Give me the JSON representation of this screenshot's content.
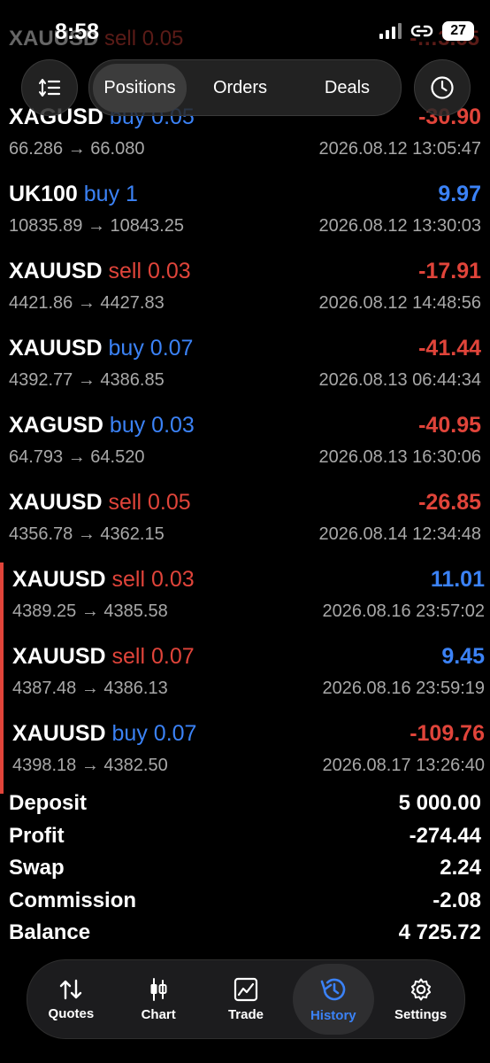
{
  "status": {
    "time": "8:58",
    "battery": "27"
  },
  "ghost": {
    "symbol": "XAUUSD",
    "side": "sell 0.05",
    "pnl": "-…3.65"
  },
  "header": {
    "tabs": [
      {
        "label": "Positions",
        "active": true
      },
      {
        "label": "Orders",
        "active": false
      },
      {
        "label": "Deals",
        "active": false
      }
    ],
    "sort_icon": "sort-icon",
    "clock_icon": "clock-icon"
  },
  "trades": [
    {
      "symbol": "XAGUSD",
      "side": "buy 0.05",
      "dir": "buy",
      "pnl": "-30.90",
      "prices": "66.286 → 66.080",
      "date": "2026.08.12 13:05:47",
      "bar": false
    },
    {
      "symbol": "UK100",
      "side": "buy 1",
      "dir": "buy",
      "pnl": "9.97",
      "prices": "10835.89 → 10843.25",
      "date": "2026.08.12 13:30:03",
      "bar": false
    },
    {
      "symbol": "XAUUSD",
      "side": "sell 0.03",
      "dir": "sell",
      "pnl": "-17.91",
      "prices": "4421.86 → 4427.83",
      "date": "2026.08.12 14:48:56",
      "bar": false
    },
    {
      "symbol": "XAUUSD",
      "side": "buy 0.07",
      "dir": "buy",
      "pnl": "-41.44",
      "prices": "4392.77 → 4386.85",
      "date": "2026.08.13 06:44:34",
      "bar": false
    },
    {
      "symbol": "XAGUSD",
      "side": "buy 0.03",
      "dir": "buy",
      "pnl": "-40.95",
      "prices": "64.793 → 64.520",
      "date": "2026.08.13 16:30:06",
      "bar": false
    },
    {
      "symbol": "XAUUSD",
      "side": "sell 0.05",
      "dir": "sell",
      "pnl": "-26.85",
      "prices": "4356.78 → 4362.15",
      "date": "2026.08.14 12:34:48",
      "bar": false
    },
    {
      "symbol": "XAUUSD",
      "side": "sell 0.03",
      "dir": "sell",
      "pnl": "11.01",
      "prices": "4389.25 → 4385.58",
      "date": "2026.08.16 23:57:02",
      "bar": true
    },
    {
      "symbol": "XAUUSD",
      "side": "sell 0.07",
      "dir": "sell",
      "pnl": "9.45",
      "prices": "4387.48 → 4386.13",
      "date": "2026.08.16 23:59:19",
      "bar": true
    },
    {
      "symbol": "XAUUSD",
      "side": "buy 0.07",
      "dir": "buy",
      "pnl": "-109.76",
      "prices": "4398.18 → 4382.50",
      "date": "2026.08.17 13:26:40",
      "bar": true
    }
  ],
  "summary": [
    {
      "label": "Deposit",
      "value": "5 000.00"
    },
    {
      "label": "Profit",
      "value": "-274.44"
    },
    {
      "label": "Swap",
      "value": "2.24"
    },
    {
      "label": "Commission",
      "value": "-2.08"
    },
    {
      "label": "Balance",
      "value": "4 725.72"
    }
  ],
  "nav": [
    {
      "label": "Quotes",
      "icon": "quotes-icon",
      "active": false
    },
    {
      "label": "Chart",
      "icon": "chart-icon",
      "active": false
    },
    {
      "label": "Trade",
      "icon": "trade-icon",
      "active": false
    },
    {
      "label": "History",
      "icon": "history-icon",
      "active": true
    },
    {
      "label": "Settings",
      "icon": "settings-icon",
      "active": false
    }
  ],
  "colors": {
    "buy": "#3b82f6",
    "sell": "#e0443a",
    "background": "#000000"
  }
}
